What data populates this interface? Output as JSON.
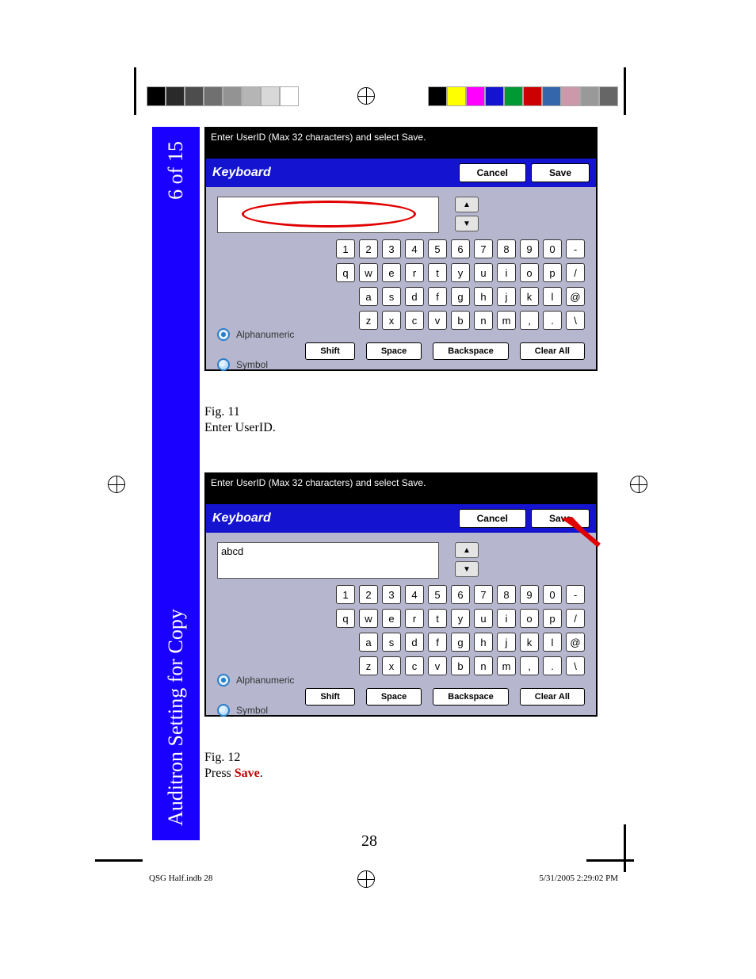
{
  "page": {
    "number": "28",
    "footer_left": "QSG Half.indb   28",
    "footer_right": "5/31/2005   2:29:02 PM"
  },
  "sidebar": {
    "page_of": "6 of 15",
    "title": "Auditron Setting for Copy"
  },
  "captions": {
    "fig11_num": "Fig. 11",
    "fig11_text": "Enter UserID.",
    "fig12_num": "Fig. 12",
    "fig12_text_pre": "Press ",
    "fig12_text_bold": "Save",
    "fig12_text_post": "."
  },
  "keyboard": {
    "instruction": "Enter UserID (Max 32 characters) and select Save.",
    "title": "Keyboard",
    "cancel": "Cancel",
    "save": "Save",
    "row1": [
      "1",
      "2",
      "3",
      "4",
      "5",
      "6",
      "7",
      "8",
      "9",
      "0",
      "-"
    ],
    "row2": [
      "q",
      "w",
      "e",
      "r",
      "t",
      "y",
      "u",
      "i",
      "o",
      "p",
      "/"
    ],
    "row3": [
      "a",
      "s",
      "d",
      "f",
      "g",
      "h",
      "j",
      "k",
      "l",
      "@"
    ],
    "row4": [
      "z",
      "x",
      "c",
      "v",
      "b",
      "n",
      "m",
      ",",
      ".",
      "\\"
    ],
    "radio_alpha": "Alphanumeric",
    "radio_symbol": "Symbol",
    "shift": "Shift",
    "space": "Space",
    "backspace": "Backspace",
    "clear": "Clear All",
    "entered_fig12": "abcd",
    "entered_fig11": ""
  },
  "printer_marks": {
    "gray_shades": [
      "#000000",
      "#2a2a2a",
      "#4d4d4d",
      "#707070",
      "#939393",
      "#b5b5b5",
      "#d8d8d8",
      "#ffffff"
    ],
    "color_cells": [
      "#000000",
      "#ffff00",
      "#ff00ff",
      "#1414d0",
      "#009933",
      "#cc0000",
      "#3366aa",
      "#cc99aa",
      "#999999",
      "#666666"
    ]
  }
}
